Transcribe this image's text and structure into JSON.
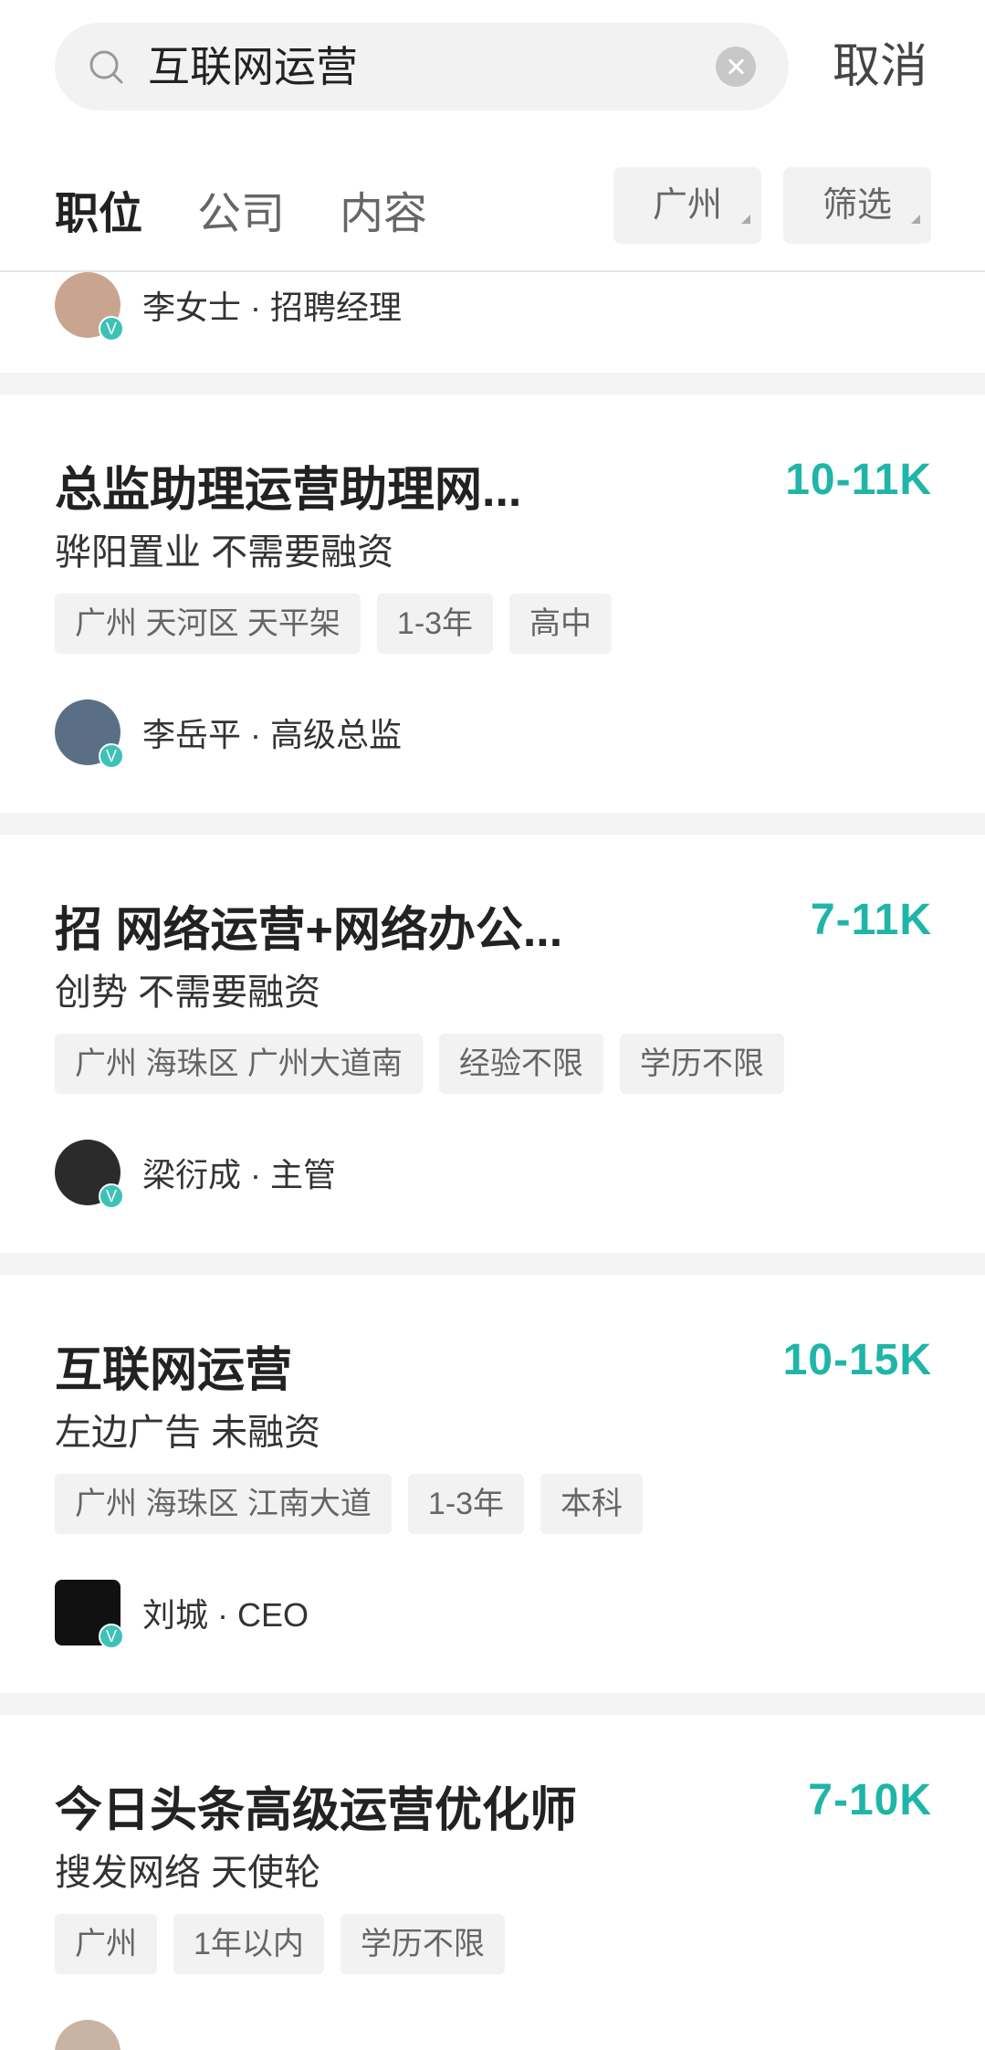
{
  "search": {
    "query": "互联网运营",
    "cancel_label": "取消"
  },
  "tabs": [
    {
      "label": "职位",
      "active": true
    },
    {
      "label": "公司",
      "active": false
    },
    {
      "label": "内容",
      "active": false
    }
  ],
  "filters": {
    "city_label": "广州",
    "filter_label": "筛选"
  },
  "partial_top_recruiter": "李女士 · 招聘经理",
  "jobs": [
    {
      "title": "总监助理运营助理网...",
      "salary": "10-11K",
      "company": "骅阳置业  不需要融资",
      "tags": [
        "广州 天河区 天平架",
        "1-3年",
        "高中"
      ],
      "recruiter": "李岳平 · 高级总监"
    },
    {
      "title": "招 网络运营+网络办公...",
      "salary": "7-11K",
      "company": "创势  不需要融资",
      "tags": [
        "广州 海珠区 广州大道南",
        "经验不限",
        "学历不限"
      ],
      "recruiter": "梁衍成 · 主管"
    },
    {
      "title": "互联网运营",
      "salary": "10-15K",
      "company": "左边广告  未融资",
      "tags": [
        "广州 海珠区 江南大道",
        "1-3年",
        "本科"
      ],
      "recruiter": "刘城 · CEO"
    },
    {
      "title": "今日头条高级运营优化师",
      "salary": "7-10K",
      "company": "搜发网络  天使轮",
      "tags": [
        "广州",
        "1年以内",
        "学历不限"
      ],
      "recruiter": ""
    }
  ],
  "badge_letter": "V",
  "colors": {
    "accent": "#1fb5a8",
    "badge": "#3cc2b6"
  }
}
